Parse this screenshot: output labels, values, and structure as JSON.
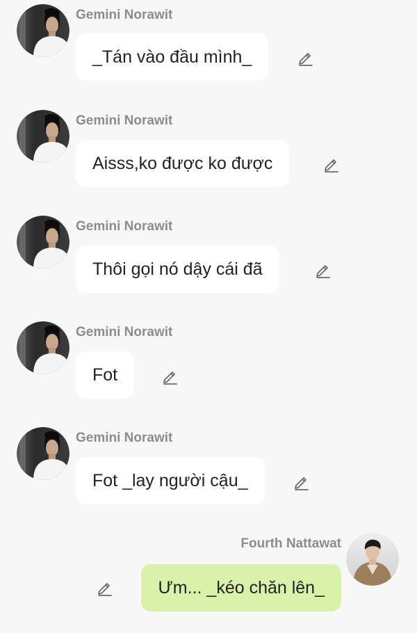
{
  "messages": [
    {
      "sender": "Gemini Norawit",
      "text": "_Tán vào đầu mình_",
      "side": "left",
      "avatar_icon": "gemini-avatar",
      "edit_icon": "pencil-icon"
    },
    {
      "sender": "Gemini Norawit",
      "text": "Aisss,ko được ko được",
      "side": "left",
      "avatar_icon": "gemini-avatar",
      "edit_icon": "pencil-icon"
    },
    {
      "sender": "Gemini Norawit",
      "text": "Thôi gọi nó dậy cái đã",
      "side": "left",
      "avatar_icon": "gemini-avatar",
      "edit_icon": "pencil-icon"
    },
    {
      "sender": "Gemini Norawit",
      "text": "Fot",
      "side": "left",
      "avatar_icon": "gemini-avatar",
      "edit_icon": "pencil-icon"
    },
    {
      "sender": "Gemini Norawit",
      "text": "Fot _lay người cậu_",
      "side": "left",
      "avatar_icon": "gemini-avatar",
      "edit_icon": "pencil-icon"
    },
    {
      "sender": "Fourth Nattawat",
      "text": "Ưm... _kéo chăn lên_",
      "side": "right",
      "avatar_icon": "fourth-avatar",
      "edit_icon": "pencil-icon"
    }
  ],
  "colors": {
    "background": "#f7f7f7",
    "bubble_received": "#ffffff",
    "bubble_sent": "#d8f3a9",
    "sender_name": "#8c8c8c",
    "message_text": "#222222"
  }
}
